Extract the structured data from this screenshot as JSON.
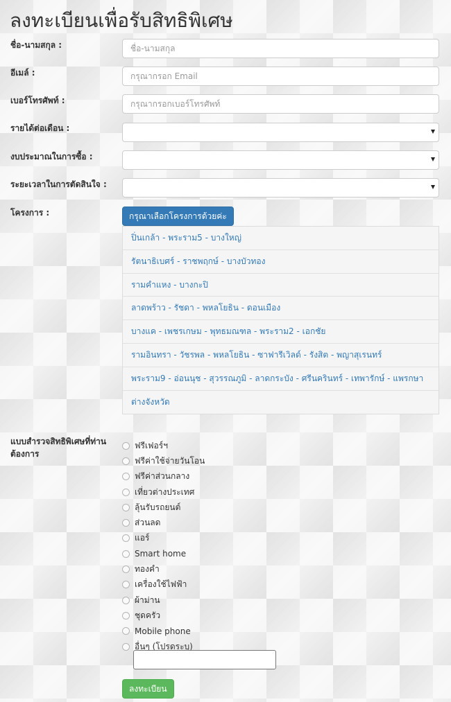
{
  "page": {
    "title": "ลงทะเบียนเพื่อรับสิทธิพิเศษ"
  },
  "form": {
    "name": {
      "label": "ชื่อ-นามสกุล :",
      "placeholder": "ชื่อ-นามสกุล",
      "value": ""
    },
    "email": {
      "label": "อีเมล์ :",
      "placeholder": "กรุณากรอก Email",
      "value": ""
    },
    "phone": {
      "label": "เบอร์โทรศัพท์ :",
      "placeholder": "กรุณากรอกเบอร์โทรศัพท์",
      "value": ""
    },
    "income": {
      "label": "รายได้ต่อเดือน :",
      "selected": ""
    },
    "budget": {
      "label": "งบประมาณในการซื้อ :",
      "selected": ""
    },
    "decision_time": {
      "label": "ระยะเวลาในการตัดสินใจ :",
      "selected": ""
    },
    "project": {
      "label": "โครงการ :",
      "button_label": "กรุณาเลือกโครงการด้วยค่ะ",
      "items": [
        "ปิ่นเกล้า - พระราม5 - บางใหญ่",
        "รัตนาธิเบศร์ - ราชพฤกษ์ - บางบัวทอง",
        "รามคำแหง - บางกะปิ",
        "ลาดพร้าว - รัชดา - พหลโยธิน - ดอนเมือง",
        "บางแค - เพชรเกษม - พุทธมณฑล - พระราม2 - เอกชัย",
        "รามอินทรา - วัชรพล - พหลโยธิน - ซาฟารีเวิลด์ - รังสิต - พญาสุเรนทร์",
        "พระราม9 - อ่อนนุช - สุวรรณภูมิ - ลาดกระบัง - ศรีนครินทร์ - เทพารักษ์ - แพรกษา",
        "ต่างจังหวัด"
      ]
    },
    "survey": {
      "label": "แบบสำรวจสิทธิพิเศษที่ท่านต้องการ",
      "options": [
        "ฟรีเฟอร์ฯ",
        "ฟรีค่าใช้จ่ายวันโอน",
        "ฟรีค่าส่วนกลาง",
        "เที่ยวต่างประเทศ",
        "ลุ้นรับรถยนต์",
        "ส่วนลด",
        "แอร์",
        "Smart home",
        "ทองคำ",
        "เครื่องใช้ไฟฟ้า",
        "ผ้าม่าน",
        "ชุดครัว",
        "Mobile phone",
        "อื่นๆ (โปรดระบุ)"
      ],
      "other_value": ""
    },
    "submit_label": "ลงทะเบียน"
  }
}
